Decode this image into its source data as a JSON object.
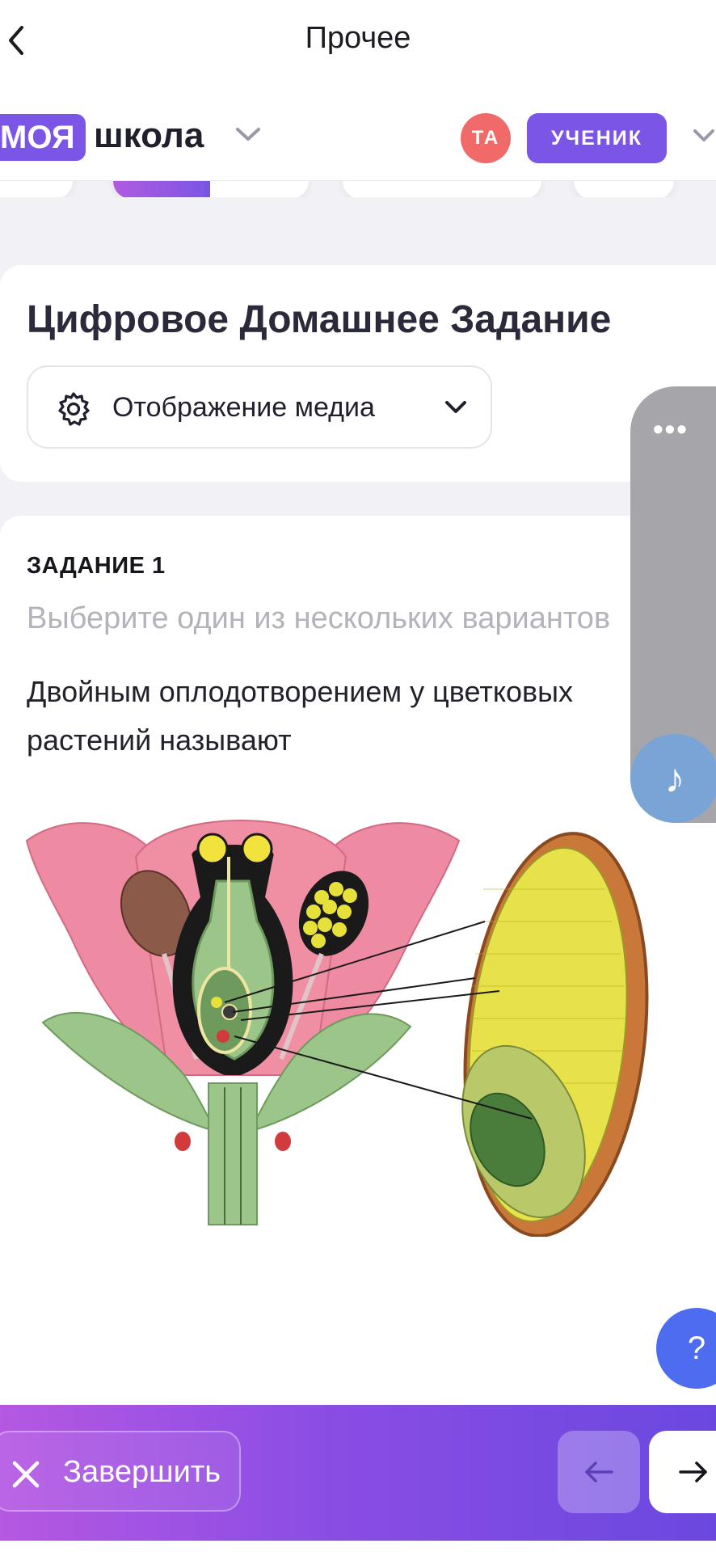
{
  "header": {
    "title": "Прочее"
  },
  "brand": {
    "part1": "МОЯ",
    "part2": "школа"
  },
  "user": {
    "initials": "ТА",
    "role": "УЧЕНИК"
  },
  "homework": {
    "title": "Цифровое Домашнее Задание",
    "media_dropdown_label": "Отображение медиа"
  },
  "task": {
    "number": "ЗАДАНИЕ 1",
    "hint": "Выберите один из нескольких вариантов",
    "question": "Двойным оплодотворением у цветковых растений называют"
  },
  "side_panel": {
    "menu_glyph": "•••",
    "music_glyph": "♪"
  },
  "help": {
    "glyph": "?"
  },
  "footer": {
    "finish_label": "Завершить"
  },
  "icons": {
    "back": "chevron-left-icon",
    "brand_dropdown": "chevron-down-icon",
    "settings": "gear-icon",
    "close": "close-icon",
    "prev": "arrow-left-icon",
    "next": "arrow-right-icon",
    "audio": "music-note-icon"
  },
  "colors": {
    "accent": "#7b55e6",
    "avatar": "#f06a6a",
    "help": "#4e6cf0",
    "audio": "#7aa4d6",
    "side_panel": "#a6a6aa"
  }
}
